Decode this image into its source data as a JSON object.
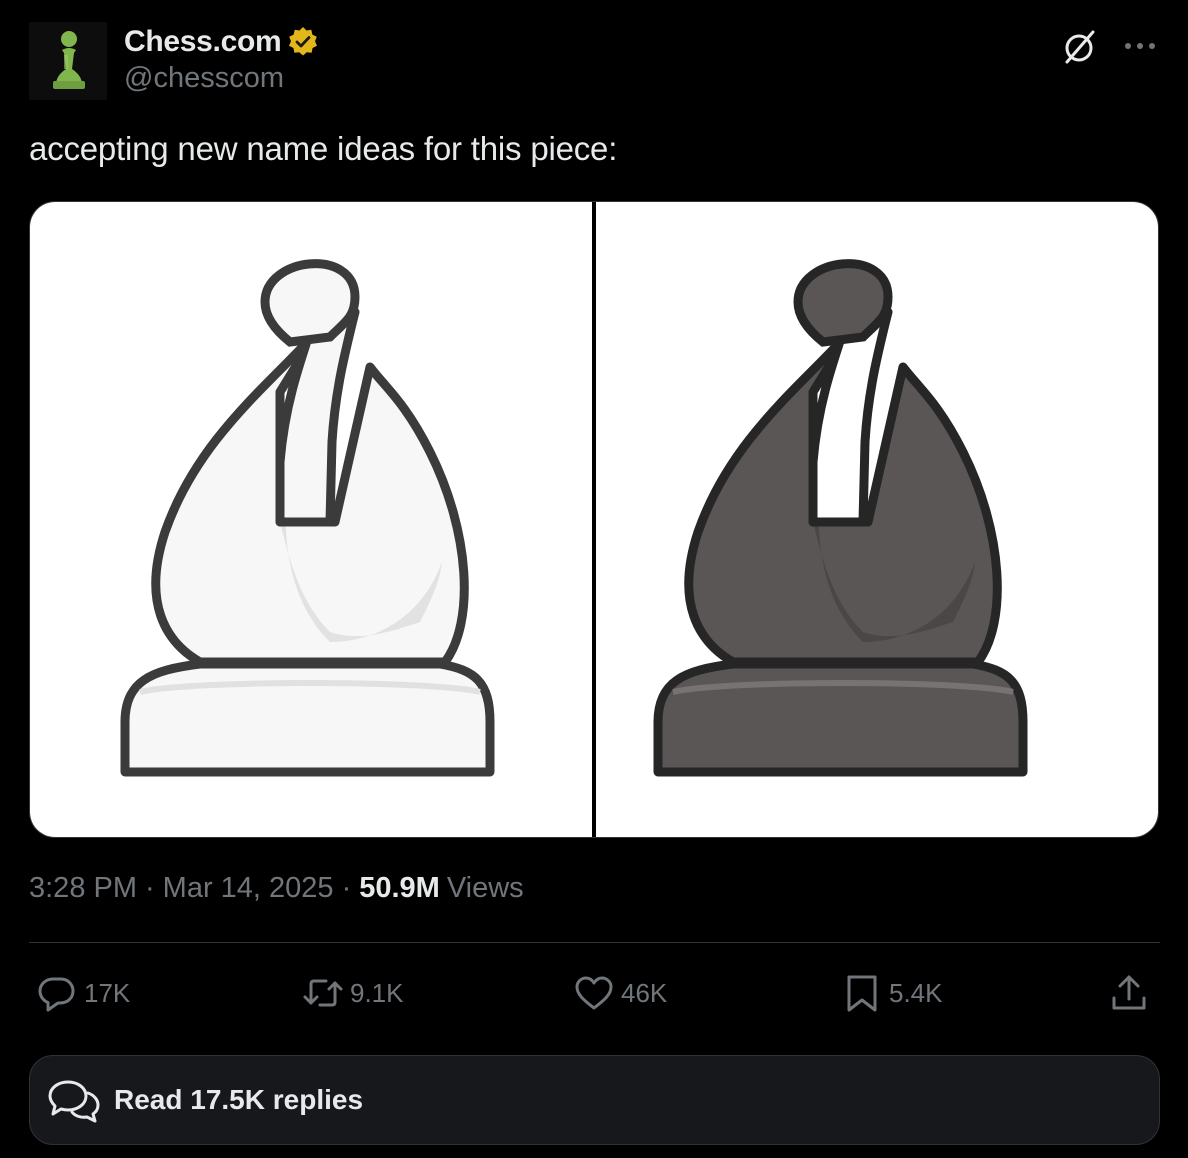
{
  "author": {
    "display_name": "Chess.com",
    "handle": "@chesscom",
    "verified_badge": "gold-verified-icon",
    "avatar": "green-pawn-icon"
  },
  "header_actions": [
    "grok-icon",
    "more-icon"
  ],
  "tweet": {
    "text": "accepting new name ideas for this piece:",
    "media": [
      {
        "subject": "white-bishop-icon",
        "background": "#ffffff"
      },
      {
        "subject": "black-bishop-icon",
        "background": "#ffffff"
      }
    ]
  },
  "meta": {
    "time": "3:28 PM",
    "separator": "·",
    "date": "Mar 14, 2025",
    "views_count": "50.9M",
    "views_label": "Views"
  },
  "actions": {
    "replies": "17K",
    "reposts": "9.1K",
    "likes": "46K",
    "bookmarks": "5.4K"
  },
  "read_replies": {
    "label": "Read 17.5K replies"
  },
  "colors": {
    "background": "#000000",
    "text_primary": "#e7e9ea",
    "text_secondary": "#71767b",
    "border": "#2f3336",
    "brand_green": "#81b64c",
    "badge_gold": "#e2b719"
  }
}
